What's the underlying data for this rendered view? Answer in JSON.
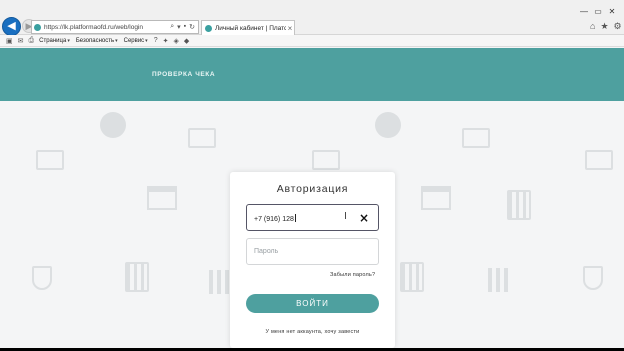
{
  "browser": {
    "url": "https://lk.platformaofd.ru/web/login",
    "tab_title": "Личный кабинет | Платфо...",
    "tab_close": "×",
    "menus": [
      "Страница",
      "Безопасность",
      "Сервис"
    ]
  },
  "site": {
    "nav_item": "ПРОВЕРКА ЧЕКА",
    "accent_color": "#4ea09f"
  },
  "login": {
    "title": "Авторизация",
    "phone_value": "+7 (916) 128",
    "clear_icon": "×",
    "password_placeholder": "Пароль",
    "forgot_label": "Забыли пароль?",
    "submit_label": "ВОЙТИ",
    "register_label": "У меня нет аккаунта, хочу завести"
  }
}
